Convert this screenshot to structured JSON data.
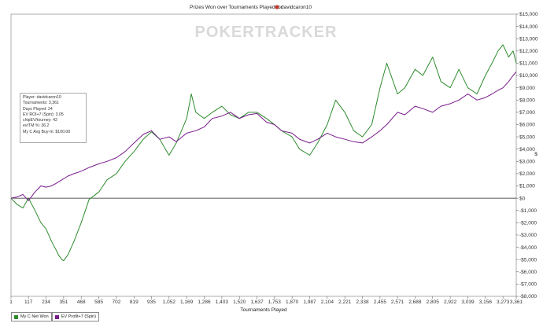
{
  "chart_data": {
    "type": "line",
    "title": "Prizes Won over Tournaments Played for",
    "player_name": "davidcaron10",
    "xlabel": "Tournaments Played",
    "ylabel": "$",
    "xlim": [
      1,
      3361
    ],
    "ylim": [
      -8000,
      15000
    ],
    "x_ticks": [
      "1",
      "117",
      "234",
      "351",
      "468",
      "585",
      "702",
      "819",
      "935",
      "1,052",
      "1,169",
      "1,286",
      "1,403",
      "1,520",
      "1,637",
      "1,753",
      "1,870",
      "1,987",
      "2,104",
      "2,221",
      "2,338",
      "2,455",
      "2,571",
      "2,688",
      "2,805",
      "2,922",
      "3,039",
      "3,156",
      "3,273",
      "3,361"
    ],
    "y_ticks": [
      "$15,000",
      "$14,000",
      "$13,000",
      "$12,000",
      "$11,000",
      "$10,000",
      "$9,000",
      "$8,000",
      "$7,000",
      "$6,000",
      "$5,000",
      "$4,000",
      "$3,000",
      "$2,000",
      "$1,000",
      "$0",
      "-$1,000",
      "-$2,000",
      "-$3,000",
      "-$4,000",
      "-$5,000",
      "-$6,000",
      "-$7,000",
      "-$8,000"
    ],
    "grid": false,
    "legend_position": "bottom-left",
    "series": [
      {
        "name": "My C Net Won",
        "color": "#2e8b2e",
        "x": [
          1,
          40,
          80,
          117,
          160,
          200,
          234,
          270,
          300,
          320,
          340,
          351,
          380,
          420,
          468,
          520,
          585,
          640,
          702,
          760,
          819,
          880,
          935,
          990,
          1052,
          1100,
          1169,
          1200,
          1230,
          1286,
          1340,
          1403,
          1460,
          1520,
          1580,
          1637,
          1700,
          1753,
          1800,
          1870,
          1920,
          1987,
          2040,
          2104,
          2160,
          2221,
          2280,
          2338,
          2400,
          2455,
          2500,
          2571,
          2620,
          2688,
          2740,
          2805,
          2860,
          2922,
          2980,
          3039,
          3100,
          3156,
          3200,
          3240,
          3273,
          3310,
          3340,
          3361
        ],
        "y": [
          0,
          -500,
          -800,
          0,
          -1000,
          -2000,
          -2500,
          -3500,
          -4200,
          -4700,
          -5000,
          -5100,
          -4600,
          -3500,
          -2000,
          -100,
          500,
          1500,
          2000,
          3000,
          3800,
          4800,
          5400,
          4800,
          3500,
          4500,
          6500,
          8500,
          7000,
          6500,
          7000,
          7500,
          6800,
          6500,
          7000,
          7000,
          6500,
          6000,
          5500,
          5000,
          4000,
          3500,
          4500,
          6000,
          8000,
          7000,
          5500,
          5000,
          6000,
          9000,
          11000,
          8500,
          9000,
          10500,
          10000,
          11500,
          9500,
          9000,
          10500,
          9000,
          8500,
          10000,
          11000,
          12000,
          12500,
          11500,
          12000,
          11000
        ]
      },
      {
        "name": "EV Profit+7 (Spin)",
        "color": "#7a1a8c",
        "x": [
          1,
          40,
          80,
          117,
          160,
          200,
          234,
          270,
          300,
          340,
          380,
          420,
          468,
          520,
          585,
          640,
          702,
          760,
          819,
          880,
          935,
          990,
          1052,
          1100,
          1169,
          1230,
          1286,
          1340,
          1403,
          1460,
          1520,
          1580,
          1637,
          1700,
          1753,
          1800,
          1870,
          1920,
          1987,
          2040,
          2104,
          2160,
          2221,
          2280,
          2338,
          2400,
          2455,
          2500,
          2571,
          2620,
          2688,
          2740,
          2805,
          2860,
          2922,
          2980,
          3039,
          3100,
          3156,
          3200,
          3240,
          3273,
          3310,
          3340,
          3361
        ],
        "y": [
          0,
          100,
          300,
          -200,
          500,
          1000,
          900,
          1000,
          1200,
          1500,
          1800,
          2000,
          2200,
          2500,
          2800,
          3000,
          3300,
          3800,
          4500,
          5200,
          5500,
          4800,
          5000,
          4600,
          5300,
          5500,
          5800,
          6500,
          6700,
          7000,
          6500,
          6800,
          6900,
          6200,
          6000,
          5500,
          5300,
          4800,
          4500,
          4800,
          5300,
          5000,
          4800,
          4600,
          4500,
          5000,
          5500,
          6000,
          7000,
          6800,
          7500,
          7300,
          7000,
          7500,
          7700,
          8000,
          8500,
          8000,
          8200,
          8500,
          8800,
          9000,
          9500,
          10000,
          10300
        ]
      }
    ]
  },
  "info_box": {
    "lines": [
      "Player: davidcaron10",
      "Tournaments: 3,361",
      "Days Played: 24",
      "EV ROI+7 (Spin): 3.05",
      "chipEV/tourney: 42",
      "evITM %: 36.2",
      "My C Avg Buy-In: $100.00"
    ]
  },
  "watermark": "POKERTRACKER",
  "legend": {
    "items": [
      {
        "label": "My C Net Won",
        "color": "#2e8b2e"
      },
      {
        "label": "EV Profit+7 (Spin)",
        "color": "#7a1a8c"
      }
    ]
  }
}
